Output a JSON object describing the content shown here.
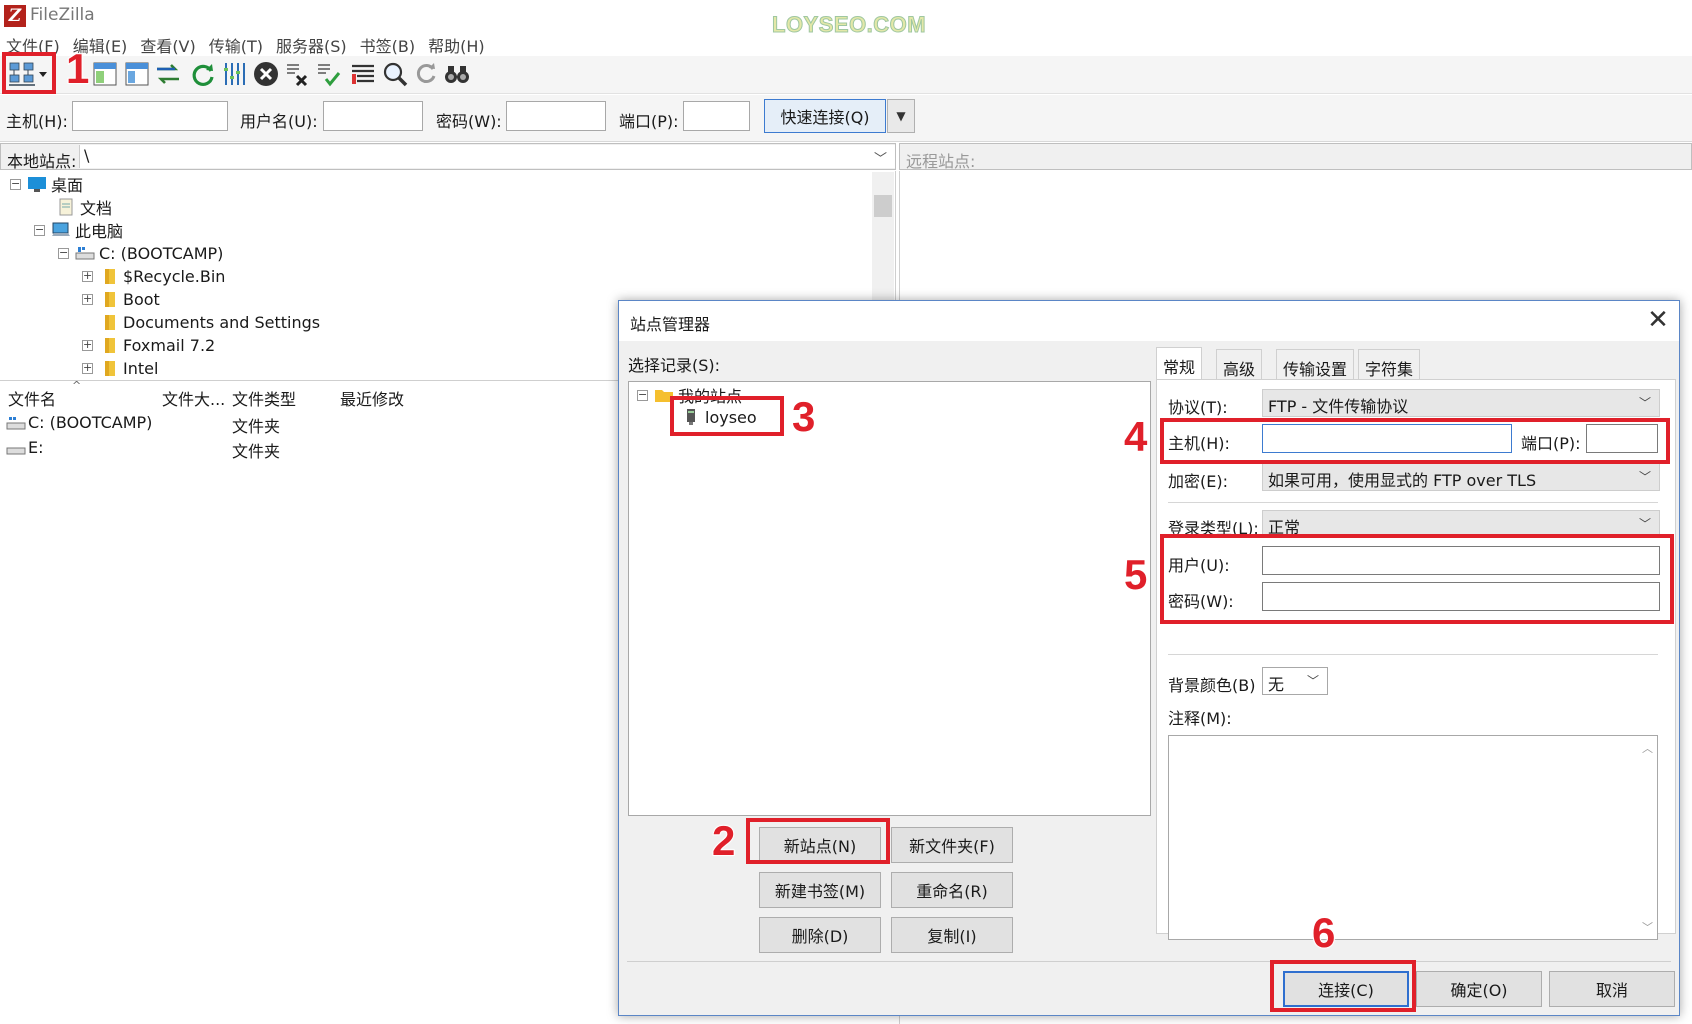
{
  "window": {
    "title": "FileZilla",
    "watermark": "LOYSEO.COM"
  },
  "menu": [
    "文件(F)",
    "编辑(E)",
    "查看(V)",
    "传输(T)",
    "服务器(S)",
    "书签(B)",
    "帮助(H)"
  ],
  "toolbar": {
    "icons": [
      "site-manager-icon",
      "message-log-icon",
      "local-tree-icon",
      "remote-tree-icon",
      "transfer-queue-icon",
      "refresh-icon",
      "process-queue-icon",
      "cancel-icon",
      "disconnect-icon",
      "reconnect-icon",
      "directory-filter-icon",
      "search-icon",
      "sync-browse-icon",
      "compare-icon"
    ]
  },
  "quickconnect": {
    "host_label": "主机(H):",
    "host_value": "",
    "user_label": "用户名(U):",
    "user_value": "",
    "pass_label": "密码(W):",
    "pass_value": "",
    "port_label": "端口(P):",
    "port_value": "",
    "button": "快速连接(Q)"
  },
  "local": {
    "label": "本地站点:",
    "path": "\\",
    "tree": [
      "桌面",
      "文档",
      "此电脑",
      "C: (BOOTCAMP)",
      "$Recycle.Bin",
      "Boot",
      "Documents and Settings",
      "Foxmail 7.2",
      "Intel"
    ],
    "columns": [
      "文件名",
      "文件大...",
      "文件类型",
      "最近修改"
    ],
    "files": [
      {
        "name": "C: (BOOTCAMP)",
        "size": "",
        "type": "文件夹",
        "modified": ""
      },
      {
        "name": "E:",
        "size": "",
        "type": "文件夹",
        "modified": ""
      }
    ]
  },
  "remote": {
    "label": "远程站点:"
  },
  "site_manager": {
    "title": "站点管理器",
    "close": "✕",
    "select_label": "选择记录(S):",
    "tree_root": "我的站点",
    "tree_site": "loyseo",
    "buttons": {
      "new_site": "新站点(N)",
      "new_folder": "新文件夹(F)",
      "new_bookmark": "新建书签(M)",
      "rename": "重命名(R)",
      "delete": "删除(D)",
      "copy": "复制(I)"
    },
    "tabs": [
      "常规",
      "高级",
      "传输设置",
      "字符集"
    ],
    "general": {
      "protocol_label": "协议(T):",
      "protocol_value": "FTP - 文件传输协议",
      "host_label": "主机(H):",
      "host_value": "",
      "port_label": "端口(P):",
      "port_value": "",
      "encryption_label": "加密(E):",
      "encryption_value": "如果可用，使用显式的 FTP over TLS",
      "logon_label": "登录类型(L):",
      "logon_value": "正常",
      "user_label": "用户(U):",
      "user_value": "",
      "password_label": "密码(W):",
      "password_value": "",
      "bg_color_label": "背景颜色(B)",
      "bg_color_value": "无",
      "comment_label": "注释(M):",
      "comment_value": ""
    },
    "footer": {
      "connect": "连接(C)",
      "ok": "确定(O)",
      "cancel": "取消"
    }
  },
  "annotations": [
    "1",
    "2",
    "3",
    "4",
    "5",
    "6"
  ],
  "colors": {
    "annotation": "#e0202a",
    "accent": "#3d7bd0",
    "logo": "#b3221b"
  }
}
